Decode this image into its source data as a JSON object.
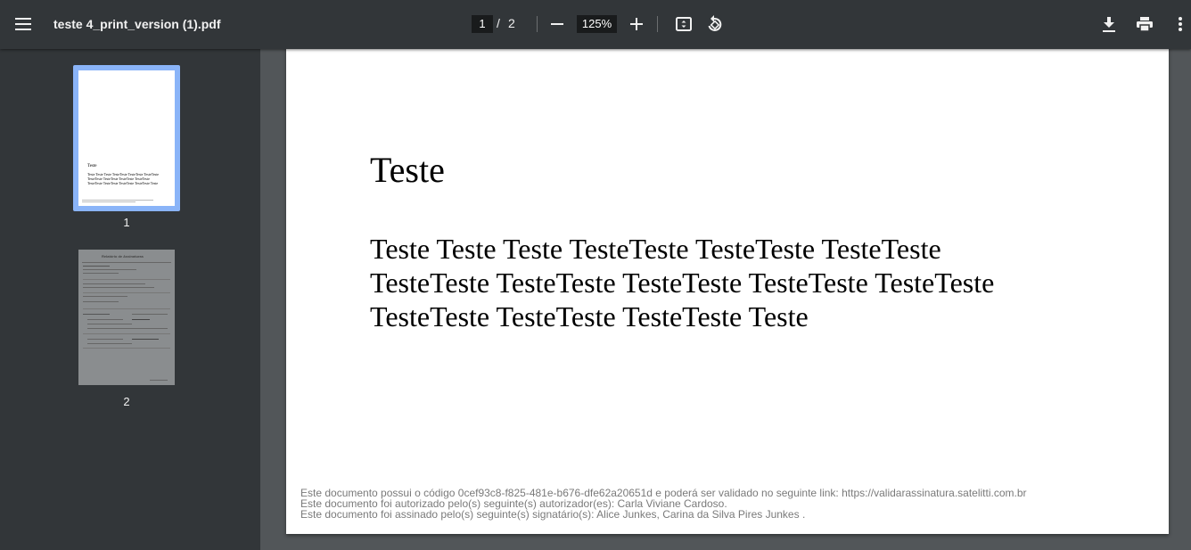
{
  "toolbar": {
    "title": "teste 4_print_version (1).pdf",
    "current_page": "1",
    "page_separator": "/",
    "total_pages": "2",
    "zoom": "125%",
    "icons": [
      "menu-icon",
      "zoom-out-icon",
      "zoom-in-icon",
      "fit-page-icon",
      "rotate-icon",
      "download-icon",
      "print-icon",
      "more-vert-icon"
    ]
  },
  "sidebar": {
    "thumbnails": [
      {
        "label": "1",
        "selected": true,
        "thumb_heading": "Teste",
        "thumb_text": "Teste Teste Teste TesteTeste TesteTeste TesteTeste TesteTeste TesteTeste TesteTeste TesteTeste TesteTeste TesteTeste TesteTeste TesteTeste Teste"
      },
      {
        "label": "2",
        "selected": false,
        "thumb_heading": "Relatório de Assinaturas"
      }
    ],
    "accent_color": "#8ab4f8"
  },
  "document": {
    "heading": "Teste",
    "body": "Teste Teste Teste TesteTeste TesteTeste TesteTeste TesteTeste TesteTeste TesteTeste TesteTeste TesteTeste TesteTeste TesteTeste TesteTeste Teste",
    "footer": [
      "Este documento possui o código 0cef93c8-f825-481e-b676-dfe62a20651d e poderá ser validado no seguinte link: https://validarassinatura.satelitti.com.br",
      "Este documento foi autorizado pelo(s) seguinte(s) autorizador(es): Carla Viviane Cardoso.",
      "Este documento foi assinado pelo(s) seguinte(s) signatário(s): Alice Junkes, Carina da Silva Pires Junkes ."
    ]
  }
}
